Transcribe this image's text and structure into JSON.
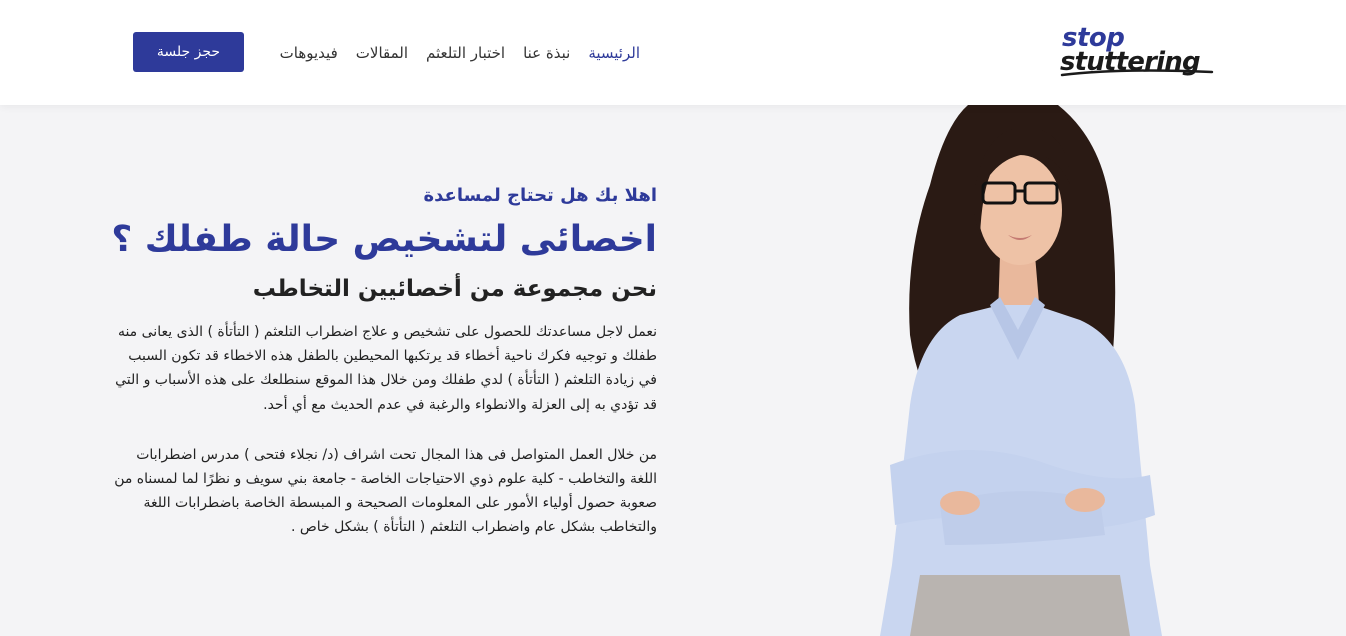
{
  "header": {
    "logo": {
      "line1": "stop",
      "line2": "stuttering"
    },
    "nav": [
      {
        "label": "الرئيسية",
        "active": true
      },
      {
        "label": "نبذة عنا",
        "active": false
      },
      {
        "label": "اختبار التلعثم",
        "active": false
      },
      {
        "label": "المقالات",
        "active": false
      },
      {
        "label": "فيديوهات",
        "active": false
      }
    ],
    "cta_label": "حجز جلسة"
  },
  "hero": {
    "greeting": "اهلا بك هل تحتاج لمساعدة",
    "headline": "اخصائى لتشخيص حالة طفلك ؟",
    "subhead": "نحن مجموعة من أخصائيين التخاطب",
    "paragraph1": "نعمل لاجل مساعدتك للحصول على تشخيص و علاج اضطراب التلعثم ( التأتأة ) الذى يعانى منه طفلك و توجيه فكرك ناحية أخطاء قد يرتكبها المحيطين بالطفل هذه الاخطاء قد تكون السبب في زيادة التلعثم ( التأتأة ) لدي طفلك ومن خلال هذا الموقع سنطلعك على هذه الأسباب و التي قد تؤدي به إلى العزلة والانطواء والرغبة في عدم الحديث مع أي أحد.",
    "paragraph2": "من خلال العمل المتواصل فى هذا المجال تحت اشراف (د/ نجلاء فتحى ) مدرس اضطرابات اللغة والتخاطب - كلية علوم ذوي الاحتياجات الخاصة - جامعة بني سويف و نظرًا لما لمسناه من صعوبة حصول أولياء الأمور على المعلومات الصحيحة و المبسطة الخاصة باضطرابات اللغة والتخاطب بشكل عام واضطراب التلعثم ( التأتأة ) بشكل خاص ."
  },
  "colors": {
    "brand": "#2e3a9a",
    "background": "#f4f4f6",
    "header_bg": "#ffffff"
  }
}
